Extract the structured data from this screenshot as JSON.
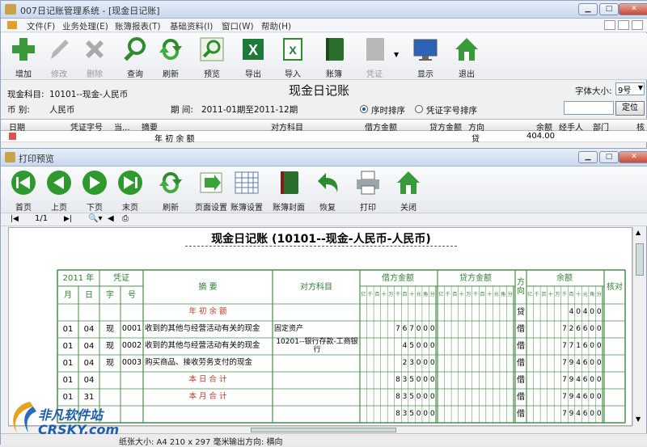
{
  "main_window": {
    "title": "007日记账管理系统 - [现金日记账]",
    "menu": [
      "文件(F)",
      "业务处理(E)",
      "账簿报表(T)",
      "基础资料(I)",
      "窗口(W)",
      "帮助(H)"
    ],
    "toolbar": [
      {
        "label": "增加",
        "icon": "add-icon",
        "enabled": true
      },
      {
        "label": "修改",
        "icon": "edit-icon",
        "enabled": false
      },
      {
        "label": "删除",
        "icon": "delete-icon",
        "enabled": false
      },
      {
        "label": "查询",
        "icon": "search-icon",
        "enabled": true
      },
      {
        "label": "刷新",
        "icon": "refresh-icon",
        "enabled": true
      },
      {
        "label": "预览",
        "icon": "preview-icon",
        "enabled": true
      },
      {
        "label": "导出",
        "icon": "excel-export-icon",
        "enabled": true
      },
      {
        "label": "导入",
        "icon": "excel-import-icon",
        "enabled": true
      },
      {
        "label": "账簿",
        "icon": "book-icon",
        "enabled": true
      },
      {
        "label": "凭证",
        "icon": "voucher-icon",
        "enabled": false
      },
      {
        "label": "显示",
        "icon": "monitor-icon",
        "enabled": true
      },
      {
        "label": "退出",
        "icon": "exit-icon",
        "enabled": true
      }
    ],
    "account_label": "现金科目:",
    "account_value": "10101--现金-人民币",
    "heading": "现金日记账",
    "font_size_label": "字体大小:",
    "font_size_value": "9号",
    "currency_label": "币    别:",
    "currency_value": "人民币",
    "period_label": "期    间:",
    "period_value": "2011-01期至2011-12期",
    "sort_options": [
      "序时排序",
      "凭证字号排序"
    ],
    "locate_button": "定位",
    "grid_headers": [
      "日期",
      "凭证字号",
      "当...",
      "摘要",
      "对方科目",
      "借方金额",
      "贷方金额",
      "方向",
      "余额",
      "经手人",
      "部门",
      "核"
    ],
    "grid_row": {
      "summary": "年 初 余 额",
      "direction": "贷",
      "balance": "404.00"
    }
  },
  "preview_window": {
    "title": "打印预览",
    "toolbar": [
      {
        "label": "首页",
        "icon": "first-page-icon"
      },
      {
        "label": "上页",
        "icon": "prev-page-icon"
      },
      {
        "label": "下页",
        "icon": "next-page-icon"
      },
      {
        "label": "末页",
        "icon": "last-page-icon"
      },
      {
        "label": "刷新",
        "icon": "refresh-icon"
      },
      {
        "label": "页面设置",
        "icon": "page-setup-icon"
      },
      {
        "label": "账簿设置",
        "icon": "book-setup-icon"
      },
      {
        "label": "账簿封面",
        "icon": "book-cover-icon"
      },
      {
        "label": "恢复",
        "icon": "undo-icon"
      },
      {
        "label": "打印",
        "icon": "printer-icon"
      },
      {
        "label": "关闭",
        "icon": "close-house-icon"
      }
    ],
    "page_indicator": "1/1",
    "report": {
      "title": "现金日记账 (10101--现金-人民币-人民币)",
      "header": {
        "year": "2011",
        "year_suffix": "年",
        "voucher": "凭证",
        "month": "月",
        "day": "日",
        "zi": "字",
        "hao": "号",
        "summary": "摘     要",
        "counter": "对方科目",
        "debit": "借方金额",
        "credit": "贷方金额",
        "direction": "方向",
        "balance": "余额",
        "check": "核对",
        "digits": [
          "亿",
          "千",
          "百",
          "十",
          "万",
          "千",
          "百",
          "十",
          "元",
          "角",
          "分"
        ]
      },
      "rows": [
        {
          "m": "",
          "d": "",
          "zi": "",
          "no": "",
          "summary": "年 初 余 额",
          "counter": "",
          "debit": "",
          "dir": "贷",
          "balance": "40400",
          "red": true
        },
        {
          "m": "01",
          "d": "04",
          "zi": "现",
          "no": "0001",
          "summary": "收到的其他与经营活动有关的现金",
          "counter": "固定资产",
          "debit": "767000",
          "dir": "借",
          "balance": "726600",
          "red": false
        },
        {
          "m": "01",
          "d": "04",
          "zi": "现",
          "no": "0002",
          "summary": "收到的其他与经营活动有关的现金",
          "counter": "10201--银行存款-工商银行",
          "debit": "45000",
          "dir": "借",
          "balance": "771600",
          "red": false
        },
        {
          "m": "01",
          "d": "04",
          "zi": "现",
          "no": "0003",
          "summary": "购买商品、接收劳务支付的现金",
          "counter": "",
          "debit": "23000",
          "dir": "借",
          "balance": "794600",
          "red": false
        },
        {
          "m": "01",
          "d": "04",
          "zi": "",
          "no": "",
          "summary": "本 日 合 计",
          "counter": "",
          "debit": "835000",
          "dir": "借",
          "balance": "794600",
          "red": true
        },
        {
          "m": "01",
          "d": "31",
          "zi": "",
          "no": "",
          "summary": "本 月 合 计",
          "counter": "",
          "debit": "835000",
          "dir": "借",
          "balance": "794600",
          "red": true
        },
        {
          "m": "",
          "d": "",
          "zi": "",
          "no": "",
          "summary": "",
          "counter": "",
          "debit": "835000",
          "dir": "借",
          "balance": "794600",
          "red": false
        }
      ]
    },
    "status": {
      "paper": "纸张大小: A4 210 x 297 毫米",
      "orientation": "输出方向: 横向"
    },
    "watermark": "非凡软件站 CRSKY.com"
  }
}
